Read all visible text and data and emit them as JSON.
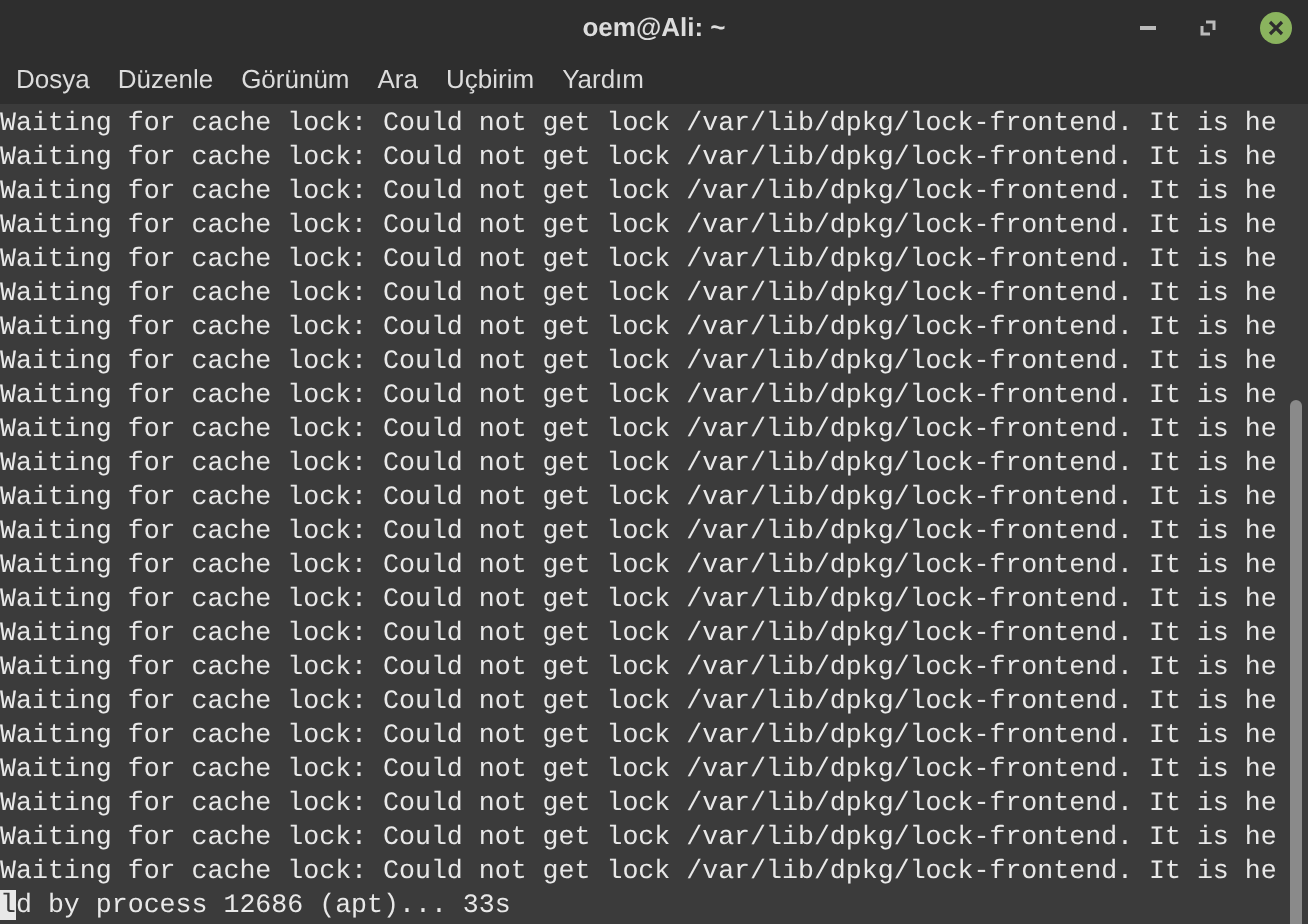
{
  "window": {
    "title": "oem@Ali: ~"
  },
  "menu": [
    "Dosya",
    "Düzenle",
    "Görünüm",
    "Ara",
    "Uçbirim",
    "Yardım"
  ],
  "terminal": {
    "lines": [
      {
        "text": "Waiting for cache lock: Could not get lock /var/lib/dpkg/lock-frontend. It is he",
        "cursor": false
      },
      {
        "text": "Waiting for cache lock: Could not get lock /var/lib/dpkg/lock-frontend. It is he",
        "cursor": false
      },
      {
        "text": "Waiting for cache lock: Could not get lock /var/lib/dpkg/lock-frontend. It is he",
        "cursor": false
      },
      {
        "text": "Waiting for cache lock: Could not get lock /var/lib/dpkg/lock-frontend. It is he",
        "cursor": false
      },
      {
        "text": "Waiting for cache lock: Could not get lock /var/lib/dpkg/lock-frontend. It is he",
        "cursor": false
      },
      {
        "text": "Waiting for cache lock: Could not get lock /var/lib/dpkg/lock-frontend. It is he",
        "cursor": false
      },
      {
        "text": "Waiting for cache lock: Could not get lock /var/lib/dpkg/lock-frontend. It is he",
        "cursor": false
      },
      {
        "text": "Waiting for cache lock: Could not get lock /var/lib/dpkg/lock-frontend. It is he",
        "cursor": false
      },
      {
        "text": "Waiting for cache lock: Could not get lock /var/lib/dpkg/lock-frontend. It is he",
        "cursor": false
      },
      {
        "text": "Waiting for cache lock: Could not get lock /var/lib/dpkg/lock-frontend. It is he",
        "cursor": false
      },
      {
        "text": "Waiting for cache lock: Could not get lock /var/lib/dpkg/lock-frontend. It is he",
        "cursor": false
      },
      {
        "text": "Waiting for cache lock: Could not get lock /var/lib/dpkg/lock-frontend. It is he",
        "cursor": false
      },
      {
        "text": "Waiting for cache lock: Could not get lock /var/lib/dpkg/lock-frontend. It is he",
        "cursor": false
      },
      {
        "text": "Waiting for cache lock: Could not get lock /var/lib/dpkg/lock-frontend. It is he",
        "cursor": false
      },
      {
        "text": "Waiting for cache lock: Could not get lock /var/lib/dpkg/lock-frontend. It is he",
        "cursor": false
      },
      {
        "text": "Waiting for cache lock: Could not get lock /var/lib/dpkg/lock-frontend. It is he",
        "cursor": false
      },
      {
        "text": "Waiting for cache lock: Could not get lock /var/lib/dpkg/lock-frontend. It is he",
        "cursor": false
      },
      {
        "text": "Waiting for cache lock: Could not get lock /var/lib/dpkg/lock-frontend. It is he",
        "cursor": false
      },
      {
        "text": "Waiting for cache lock: Could not get lock /var/lib/dpkg/lock-frontend. It is he",
        "cursor": false
      },
      {
        "text": "Waiting for cache lock: Could not get lock /var/lib/dpkg/lock-frontend. It is he",
        "cursor": false
      },
      {
        "text": "Waiting for cache lock: Could not get lock /var/lib/dpkg/lock-frontend. It is he",
        "cursor": false
      },
      {
        "text": "Waiting for cache lock: Could not get lock /var/lib/dpkg/lock-frontend. It is he",
        "cursor": false
      },
      {
        "text": "Waiting for cache lock: Could not get lock /var/lib/dpkg/lock-frontend. It is he",
        "cursor": false
      },
      {
        "text": "ld by process 12686 (apt)... 33s",
        "cursor": true
      }
    ]
  }
}
